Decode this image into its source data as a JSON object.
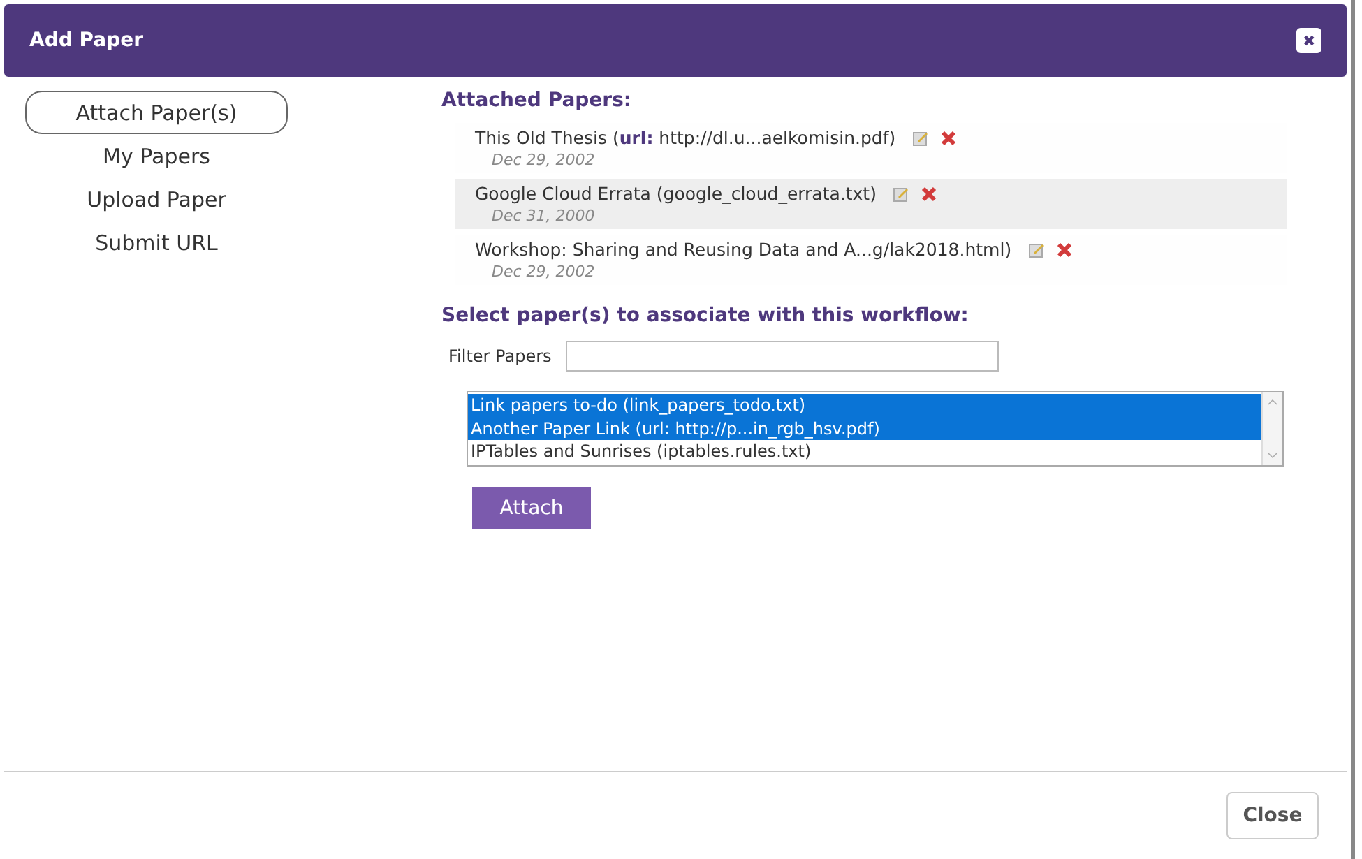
{
  "window": {
    "title": "Add Paper",
    "close_icon": "✖"
  },
  "sidebar": {
    "items": [
      {
        "label": "Attach Paper(s)",
        "selected": true
      },
      {
        "label": "My Papers",
        "selected": false
      },
      {
        "label": "Upload Paper",
        "selected": false
      },
      {
        "label": "Submit URL",
        "selected": false
      }
    ]
  },
  "attached": {
    "heading": "Attached Papers:",
    "papers": [
      {
        "title": "This Old Thesis (**url:** http://dl.u...aelkomisin.pdf)",
        "date": "Dec 29, 2002",
        "selected": false
      },
      {
        "title": "Google Cloud Errata (google_cloud_errata.txt)",
        "date": "Dec 31, 2000",
        "selected": true
      },
      {
        "title": "Workshop: Sharing and Reusing Data and A...g/lak2018.html)",
        "date": "Dec 29, 2002",
        "selected": false
      }
    ]
  },
  "select": {
    "heading": "Select paper(s) to associate with this workflow:",
    "filter_label": "Filter Papers",
    "options": [
      {
        "label": "Link papers to-do (link_papers_todo.txt)",
        "selected": true
      },
      {
        "label": "Another Paper Link (url: http://p...in_rgb_hsv.pdf)",
        "selected": true
      },
      {
        "label": "IPTables and Sunrises (iptables.rules.txt)",
        "selected": false
      }
    ],
    "attach_button": "Attach"
  },
  "footer": {
    "close_button": "Close"
  }
}
